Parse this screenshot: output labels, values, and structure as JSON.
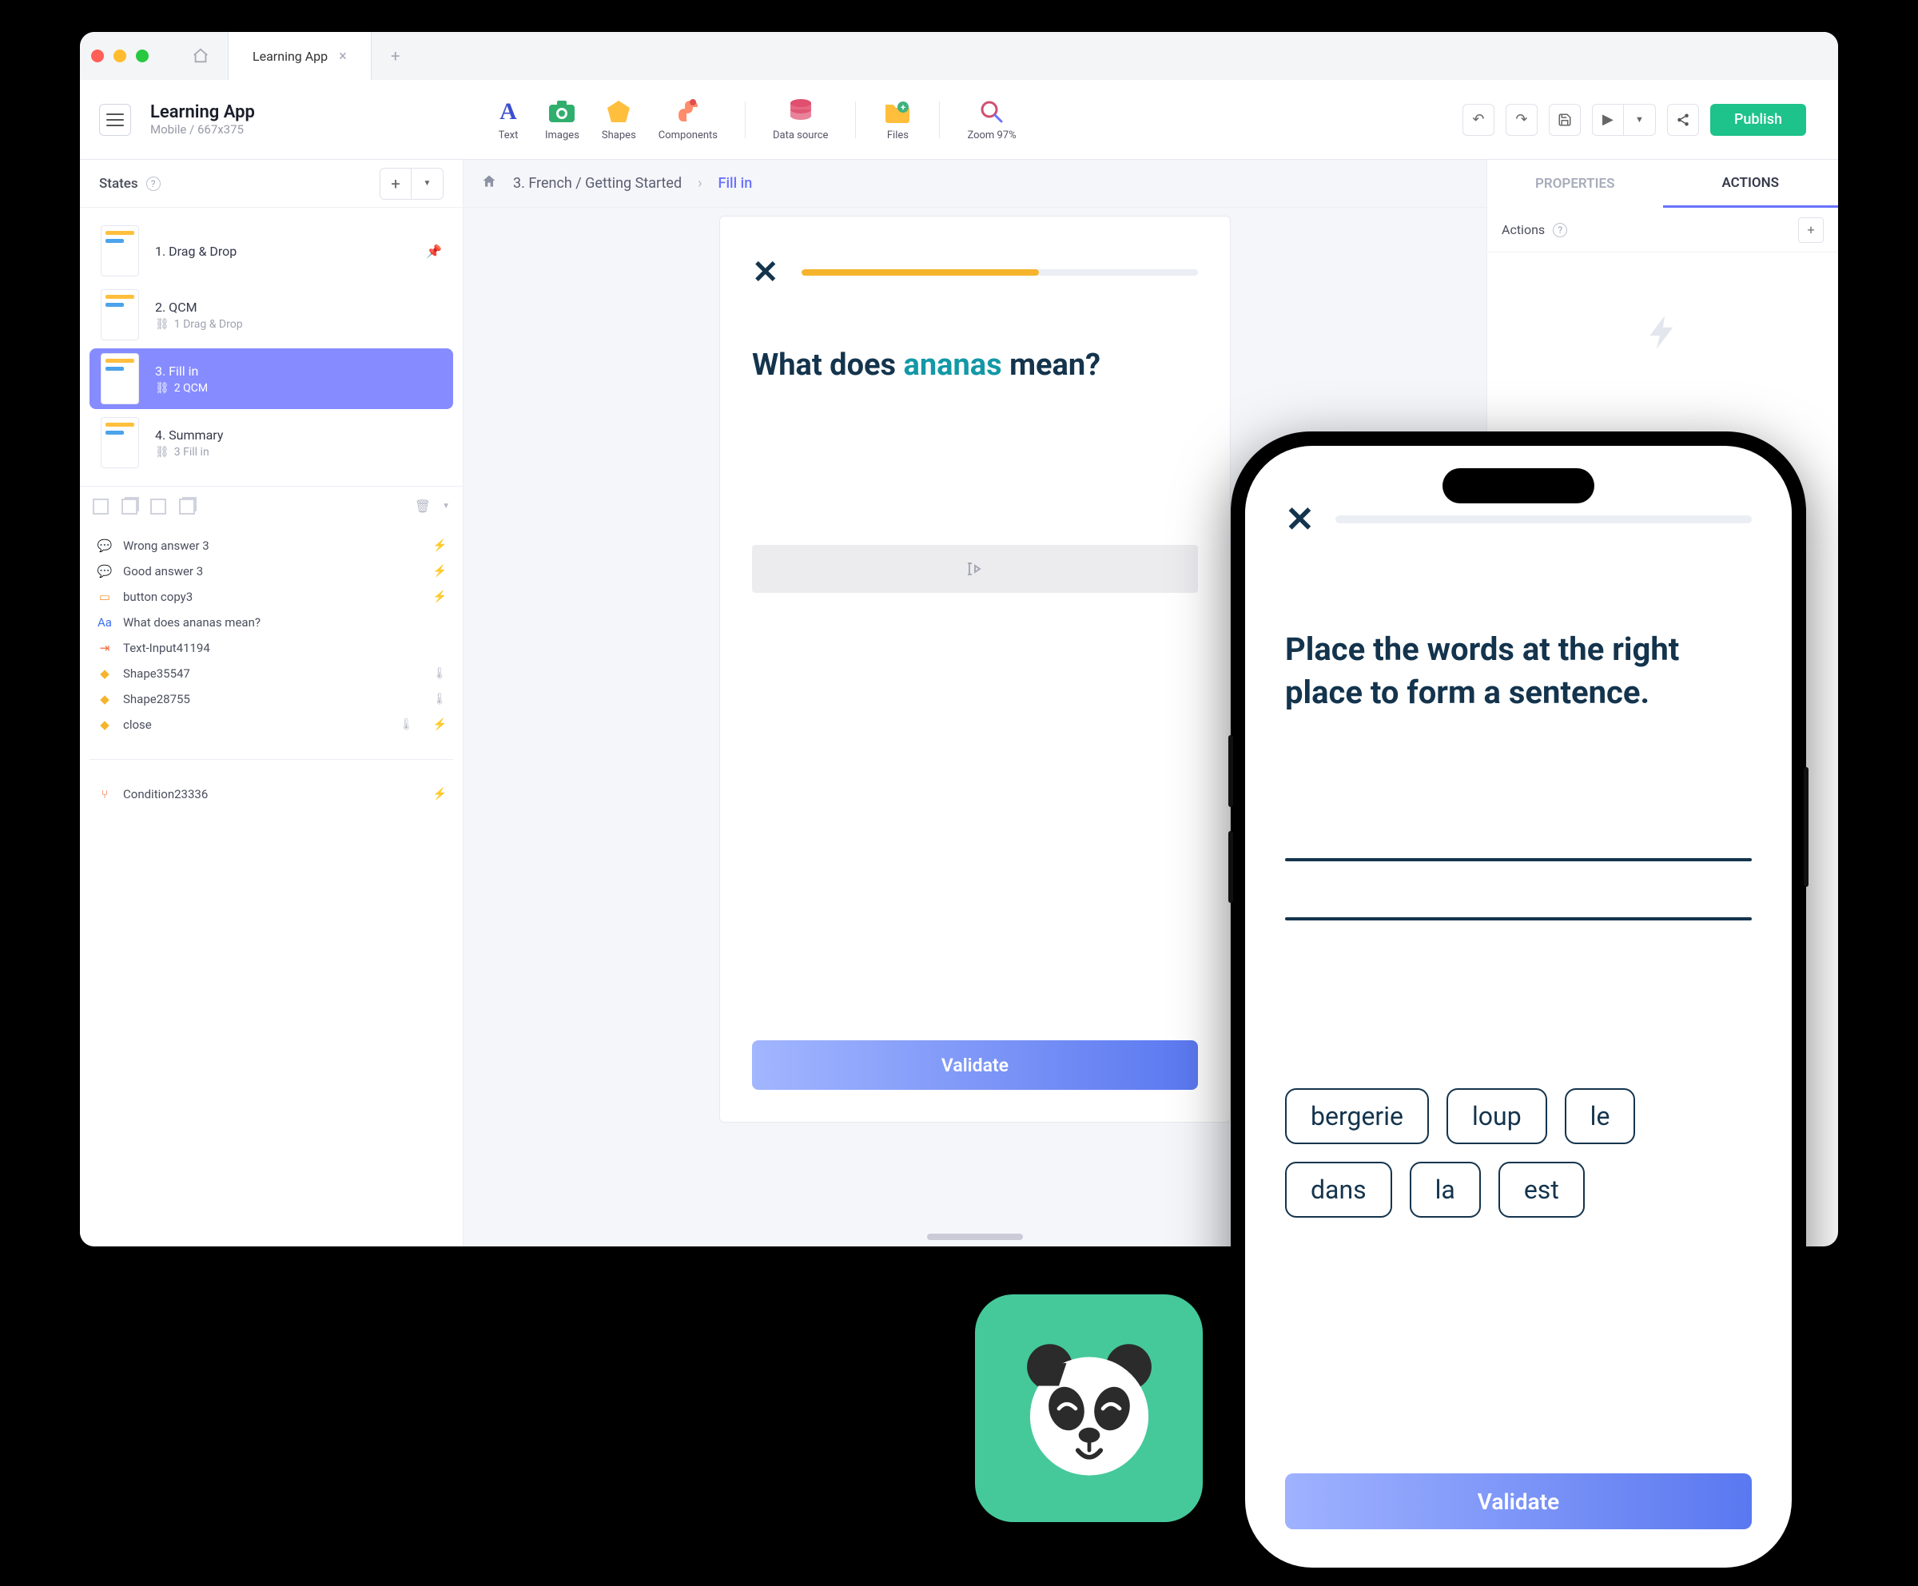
{
  "window": {
    "tab_title": "Learning App"
  },
  "project": {
    "title": "Learning App",
    "subtitle": "Mobile / 667x375"
  },
  "toolbar": {
    "text": "Text",
    "images": "Images",
    "shapes": "Shapes",
    "components": "Components",
    "datasource": "Data source",
    "files": "Files",
    "zoom": "Zoom 97%",
    "publish": "Publish"
  },
  "states": {
    "header": "States",
    "items": [
      {
        "name": "1. Drag & Drop",
        "sub": ""
      },
      {
        "name": "2. QCM",
        "sub": "1  Drag & Drop"
      },
      {
        "name": "3. Fill in",
        "sub": "2  QCM"
      },
      {
        "name": "4. Summary",
        "sub": "3  Fill in"
      }
    ]
  },
  "layers": [
    {
      "icon": "💬",
      "label": "Wrong answer 3",
      "trail": "bolt"
    },
    {
      "icon": "💬",
      "label": "Good answer 3",
      "trail": "bolt"
    },
    {
      "icon": "▭",
      "label": "button copy3",
      "trail": "bolt"
    },
    {
      "icon": "Aa",
      "label": "What does ananas mean?",
      "trail": ""
    },
    {
      "icon": "⇥",
      "label": "Text-Input41194",
      "trail": ""
    },
    {
      "icon": "◆",
      "label": "Shape35547",
      "trail": "therm"
    },
    {
      "icon": "◆",
      "label": "Shape28755",
      "trail": "therm"
    },
    {
      "icon": "◆",
      "label": "close",
      "trail": "both"
    },
    {
      "icon": "⑂",
      "label": "Condition23336",
      "trail": "bolt"
    }
  ],
  "breadcrumb": {
    "path": "3. French / Getting Started",
    "current": "Fill in"
  },
  "canvas": {
    "question_pre": "What does ",
    "question_kw": "ananas",
    "question_post": " mean?",
    "validate": "Validate"
  },
  "right": {
    "tab_properties": "PROPERTIES",
    "tab_actions": "ACTIONS",
    "actions_label": "Actions"
  },
  "phone": {
    "prompt": "Place the words at the right place to form a sentence.",
    "chips": [
      "bergerie",
      "loup",
      "le",
      "dans",
      "la",
      "est"
    ],
    "validate": "Validate"
  }
}
